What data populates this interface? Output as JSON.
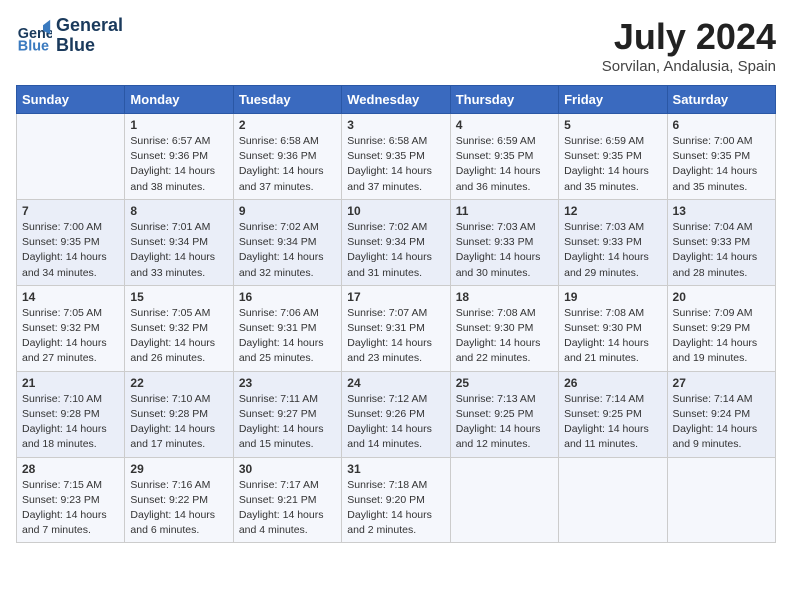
{
  "logo": {
    "line1": "General",
    "line2": "Blue"
  },
  "title": "July 2024",
  "subtitle": "Sorvilan, Andalusia, Spain",
  "headers": [
    "Sunday",
    "Monday",
    "Tuesday",
    "Wednesday",
    "Thursday",
    "Friday",
    "Saturday"
  ],
  "weeks": [
    [
      {
        "day": "",
        "sunrise": "",
        "sunset": "",
        "daylight": ""
      },
      {
        "day": "1",
        "sunrise": "Sunrise: 6:57 AM",
        "sunset": "Sunset: 9:36 PM",
        "daylight": "Daylight: 14 hours and 38 minutes."
      },
      {
        "day": "2",
        "sunrise": "Sunrise: 6:58 AM",
        "sunset": "Sunset: 9:36 PM",
        "daylight": "Daylight: 14 hours and 37 minutes."
      },
      {
        "day": "3",
        "sunrise": "Sunrise: 6:58 AM",
        "sunset": "Sunset: 9:35 PM",
        "daylight": "Daylight: 14 hours and 37 minutes."
      },
      {
        "day": "4",
        "sunrise": "Sunrise: 6:59 AM",
        "sunset": "Sunset: 9:35 PM",
        "daylight": "Daylight: 14 hours and 36 minutes."
      },
      {
        "day": "5",
        "sunrise": "Sunrise: 6:59 AM",
        "sunset": "Sunset: 9:35 PM",
        "daylight": "Daylight: 14 hours and 35 minutes."
      },
      {
        "day": "6",
        "sunrise": "Sunrise: 7:00 AM",
        "sunset": "Sunset: 9:35 PM",
        "daylight": "Daylight: 14 hours and 35 minutes."
      }
    ],
    [
      {
        "day": "7",
        "sunrise": "Sunrise: 7:00 AM",
        "sunset": "Sunset: 9:35 PM",
        "daylight": "Daylight: 14 hours and 34 minutes."
      },
      {
        "day": "8",
        "sunrise": "Sunrise: 7:01 AM",
        "sunset": "Sunset: 9:34 PM",
        "daylight": "Daylight: 14 hours and 33 minutes."
      },
      {
        "day": "9",
        "sunrise": "Sunrise: 7:02 AM",
        "sunset": "Sunset: 9:34 PM",
        "daylight": "Daylight: 14 hours and 32 minutes."
      },
      {
        "day": "10",
        "sunrise": "Sunrise: 7:02 AM",
        "sunset": "Sunset: 9:34 PM",
        "daylight": "Daylight: 14 hours and 31 minutes."
      },
      {
        "day": "11",
        "sunrise": "Sunrise: 7:03 AM",
        "sunset": "Sunset: 9:33 PM",
        "daylight": "Daylight: 14 hours and 30 minutes."
      },
      {
        "day": "12",
        "sunrise": "Sunrise: 7:03 AM",
        "sunset": "Sunset: 9:33 PM",
        "daylight": "Daylight: 14 hours and 29 minutes."
      },
      {
        "day": "13",
        "sunrise": "Sunrise: 7:04 AM",
        "sunset": "Sunset: 9:33 PM",
        "daylight": "Daylight: 14 hours and 28 minutes."
      }
    ],
    [
      {
        "day": "14",
        "sunrise": "Sunrise: 7:05 AM",
        "sunset": "Sunset: 9:32 PM",
        "daylight": "Daylight: 14 hours and 27 minutes."
      },
      {
        "day": "15",
        "sunrise": "Sunrise: 7:05 AM",
        "sunset": "Sunset: 9:32 PM",
        "daylight": "Daylight: 14 hours and 26 minutes."
      },
      {
        "day": "16",
        "sunrise": "Sunrise: 7:06 AM",
        "sunset": "Sunset: 9:31 PM",
        "daylight": "Daylight: 14 hours and 25 minutes."
      },
      {
        "day": "17",
        "sunrise": "Sunrise: 7:07 AM",
        "sunset": "Sunset: 9:31 PM",
        "daylight": "Daylight: 14 hours and 23 minutes."
      },
      {
        "day": "18",
        "sunrise": "Sunrise: 7:08 AM",
        "sunset": "Sunset: 9:30 PM",
        "daylight": "Daylight: 14 hours and 22 minutes."
      },
      {
        "day": "19",
        "sunrise": "Sunrise: 7:08 AM",
        "sunset": "Sunset: 9:30 PM",
        "daylight": "Daylight: 14 hours and 21 minutes."
      },
      {
        "day": "20",
        "sunrise": "Sunrise: 7:09 AM",
        "sunset": "Sunset: 9:29 PM",
        "daylight": "Daylight: 14 hours and 19 minutes."
      }
    ],
    [
      {
        "day": "21",
        "sunrise": "Sunrise: 7:10 AM",
        "sunset": "Sunset: 9:28 PM",
        "daylight": "Daylight: 14 hours and 18 minutes."
      },
      {
        "day": "22",
        "sunrise": "Sunrise: 7:10 AM",
        "sunset": "Sunset: 9:28 PM",
        "daylight": "Daylight: 14 hours and 17 minutes."
      },
      {
        "day": "23",
        "sunrise": "Sunrise: 7:11 AM",
        "sunset": "Sunset: 9:27 PM",
        "daylight": "Daylight: 14 hours and 15 minutes."
      },
      {
        "day": "24",
        "sunrise": "Sunrise: 7:12 AM",
        "sunset": "Sunset: 9:26 PM",
        "daylight": "Daylight: 14 hours and 14 minutes."
      },
      {
        "day": "25",
        "sunrise": "Sunrise: 7:13 AM",
        "sunset": "Sunset: 9:25 PM",
        "daylight": "Daylight: 14 hours and 12 minutes."
      },
      {
        "day": "26",
        "sunrise": "Sunrise: 7:14 AM",
        "sunset": "Sunset: 9:25 PM",
        "daylight": "Daylight: 14 hours and 11 minutes."
      },
      {
        "day": "27",
        "sunrise": "Sunrise: 7:14 AM",
        "sunset": "Sunset: 9:24 PM",
        "daylight": "Daylight: 14 hours and 9 minutes."
      }
    ],
    [
      {
        "day": "28",
        "sunrise": "Sunrise: 7:15 AM",
        "sunset": "Sunset: 9:23 PM",
        "daylight": "Daylight: 14 hours and 7 minutes."
      },
      {
        "day": "29",
        "sunrise": "Sunrise: 7:16 AM",
        "sunset": "Sunset: 9:22 PM",
        "daylight": "Daylight: 14 hours and 6 minutes."
      },
      {
        "day": "30",
        "sunrise": "Sunrise: 7:17 AM",
        "sunset": "Sunset: 9:21 PM",
        "daylight": "Daylight: 14 hours and 4 minutes."
      },
      {
        "day": "31",
        "sunrise": "Sunrise: 7:18 AM",
        "sunset": "Sunset: 9:20 PM",
        "daylight": "Daylight: 14 hours and 2 minutes."
      },
      {
        "day": "",
        "sunrise": "",
        "sunset": "",
        "daylight": ""
      },
      {
        "day": "",
        "sunrise": "",
        "sunset": "",
        "daylight": ""
      },
      {
        "day": "",
        "sunrise": "",
        "sunset": "",
        "daylight": ""
      }
    ]
  ]
}
